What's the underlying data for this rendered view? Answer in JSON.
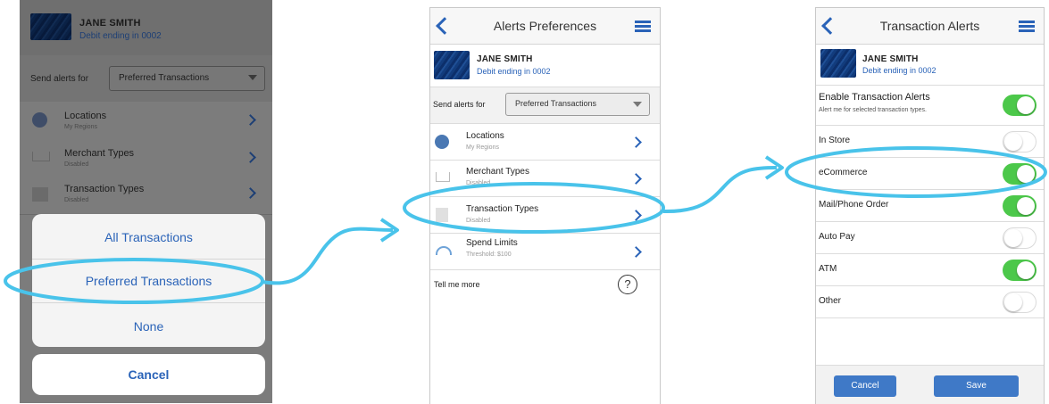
{
  "account": {
    "name": "JANE SMITH",
    "card": "Debit ending in 0002"
  },
  "screen1": {
    "send_label": "Send alerts for",
    "send_value": "Preferred Transactions",
    "rows": [
      {
        "title": "Locations",
        "sub": "My Regions"
      },
      {
        "title": "Merchant Types",
        "sub": "Disabled"
      },
      {
        "title": "Transaction Types",
        "sub": "Disabled"
      }
    ],
    "options": [
      "All Transactions",
      "Preferred Transactions",
      "None"
    ],
    "cancel": "Cancel"
  },
  "screen2": {
    "title": "Alerts Preferences",
    "send_label": "Send alerts for",
    "send_value": "Preferred Transactions",
    "rows": [
      {
        "title": "Locations",
        "sub": "My Regions"
      },
      {
        "title": "Merchant Types",
        "sub": "Disabled"
      },
      {
        "title": "Transaction Types",
        "sub": "Disabled"
      },
      {
        "title": "Spend Limits",
        "sub": "Threshold: $100"
      }
    ],
    "tell_me_more": "Tell me more",
    "help_symbol": "?"
  },
  "screen3": {
    "title": "Transaction Alerts",
    "enable_title": "Enable Transaction Alerts",
    "enable_sub": "Alert me for selected transaction types.",
    "enable_on": true,
    "types": [
      {
        "label": "In Store",
        "on": false
      },
      {
        "label": "eCommerce",
        "on": true
      },
      {
        "label": "Mail/Phone Order",
        "on": true
      },
      {
        "label": "Auto Pay",
        "on": false
      },
      {
        "label": "ATM",
        "on": true
      },
      {
        "label": "Other",
        "on": false
      }
    ],
    "cancel": "Cancel",
    "save": "Save"
  },
  "colors": {
    "accent": "#2a63b8",
    "highlight": "#49c3ea",
    "toggle_on": "#4cc84a",
    "button": "#3f79c7"
  }
}
